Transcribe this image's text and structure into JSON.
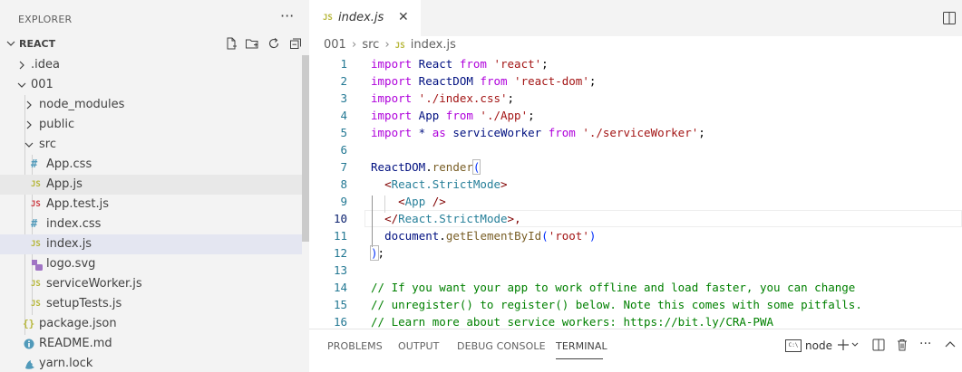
{
  "sidebar": {
    "title": "EXPLORER",
    "more_label": "···",
    "folder": "REACT",
    "tree": [
      {
        "label": ".idea",
        "type": "folder",
        "expanded": false,
        "depth": 0
      },
      {
        "label": "001",
        "type": "folder",
        "expanded": true,
        "depth": 0
      },
      {
        "label": "node_modules",
        "type": "folder",
        "expanded": false,
        "depth": 1
      },
      {
        "label": "public",
        "type": "folder",
        "expanded": false,
        "depth": 1
      },
      {
        "label": "src",
        "type": "folder",
        "expanded": true,
        "depth": 1
      },
      {
        "label": "App.css",
        "type": "css",
        "depth": 2
      },
      {
        "label": "App.js",
        "type": "js",
        "depth": 2
      },
      {
        "label": "App.test.js",
        "type": "jstest",
        "depth": 2
      },
      {
        "label": "index.css",
        "type": "css",
        "depth": 2
      },
      {
        "label": "index.js",
        "type": "js",
        "depth": 2
      },
      {
        "label": "logo.svg",
        "type": "svg",
        "depth": 2
      },
      {
        "label": "serviceWorker.js",
        "type": "js",
        "depth": 2
      },
      {
        "label": "setupTests.js",
        "type": "js",
        "depth": 2
      },
      {
        "label": "package.json",
        "type": "json",
        "depth": 1
      },
      {
        "label": "README.md",
        "type": "md",
        "depth": 1
      },
      {
        "label": "yarn.lock",
        "type": "yarn",
        "depth": 1
      }
    ]
  },
  "tab": {
    "badge": "JS",
    "name": "index.js",
    "close": "✕"
  },
  "breadcrumb": {
    "part1": "001",
    "sep": "›",
    "part2": "src",
    "badge": "JS",
    "part3": "index.js"
  },
  "code": {
    "line_numbers": [
      "1",
      "2",
      "3",
      "4",
      "5",
      "6",
      "7",
      "8",
      "9",
      "10",
      "11",
      "12",
      "13",
      "14",
      "15",
      "16"
    ],
    "current_line": "10",
    "lines": {
      "l1": [
        "import",
        " React ",
        "from",
        " 'react'",
        ";"
      ],
      "l2": [
        "import",
        " ReactDOM ",
        "from",
        " 'react-dom'",
        ";"
      ],
      "l3": [
        "import",
        " './index.css'",
        ";"
      ],
      "l4": [
        "import",
        " App ",
        "from",
        " './App'",
        ";"
      ],
      "l5": [
        "import",
        " * ",
        "as",
        " serviceWorker ",
        "from",
        " './serviceWorker'",
        ";"
      ],
      "l7": [
        "ReactDOM",
        ".",
        "render",
        "("
      ],
      "l8": [
        "<",
        "React.StrictMode",
        ">"
      ],
      "l9": [
        "<",
        "App",
        " />"
      ],
      "l10": [
        "</",
        "React.StrictMode",
        ">,"
      ],
      "l11": [
        "document",
        ".",
        "getElementById",
        "(",
        "'root'",
        ")"
      ],
      "l12": [
        ")",
        ";"
      ],
      "l14": "// If you want your app to work offline and load faster, you can change",
      "l15": "// unregister() to register() below. Note this comes with some pitfalls.",
      "l16": "// Learn more about service workers: https://bit.ly/CRA-PWA"
    }
  },
  "panel": {
    "tabs": [
      "PROBLEMS",
      "OUTPUT",
      "DEBUG CONSOLE",
      "TERMINAL"
    ],
    "active_tab": "TERMINAL",
    "terminal_name": "node",
    "terminal_icon_text": "C:\\"
  }
}
